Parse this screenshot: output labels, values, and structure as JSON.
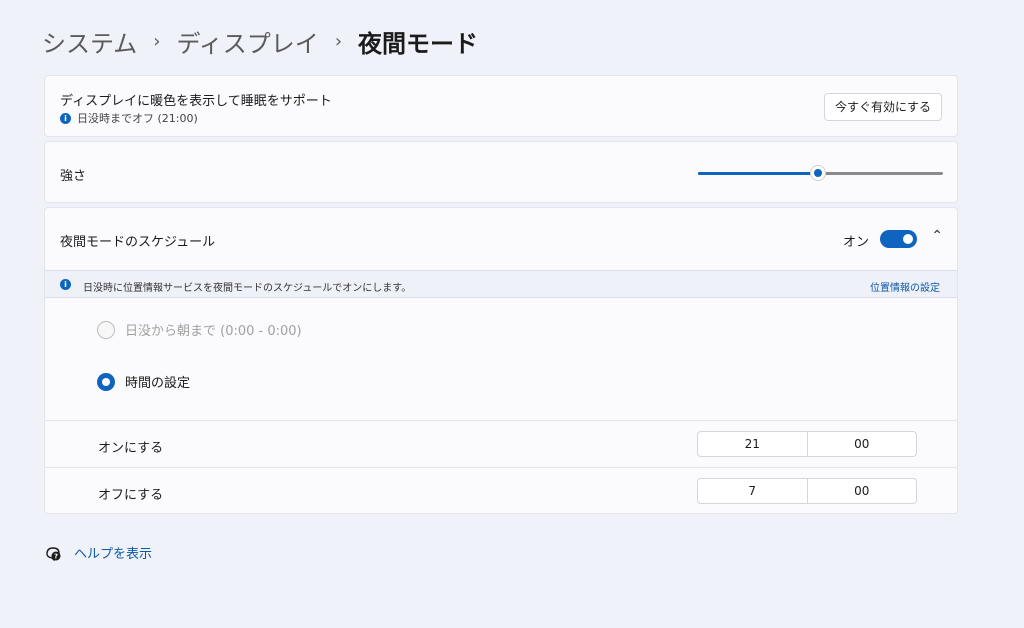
{
  "breadcrumb": {
    "items": [
      "システム",
      "ディスプレイ",
      "夜間モード"
    ],
    "separator": "›"
  },
  "night_mode": {
    "title": "ディスプレイに暖色を表示して睡眠をサポート",
    "status": "日没時までオフ (21:00)",
    "enable_button": "今すぐ有効にする"
  },
  "strength": {
    "label": "強さ",
    "value_fraction": 0.49
  },
  "schedule": {
    "title": "夜間モードのスケジュール",
    "toggle_label": "オン",
    "toggle_on": true,
    "info_text": "日没時に位置情報サービスを夜間モードのスケジュールでオンにします。",
    "info_link": "位置情報の設定",
    "options": [
      {
        "label": "日没から朝まで (0:00 - 0:00)",
        "selected": false,
        "disabled": true
      },
      {
        "label": "時間の設定",
        "selected": true,
        "disabled": false
      }
    ],
    "turn_on": {
      "label": "オンにする",
      "hour": "21",
      "minute": "00"
    },
    "turn_off": {
      "label": "オフにする",
      "hour": "7",
      "minute": "00"
    }
  },
  "help": {
    "label": "ヘルプを表示"
  },
  "colors": {
    "accent": "#0f64c0",
    "background": "#eff2f9",
    "link": "#0f58a8"
  }
}
